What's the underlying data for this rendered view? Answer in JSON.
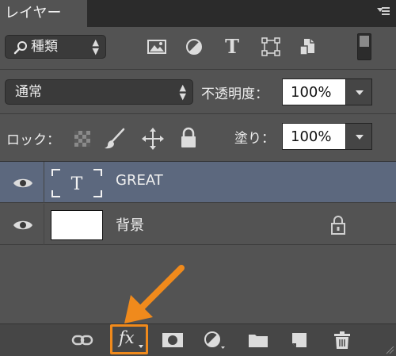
{
  "panel": {
    "tab_title": "レイヤー"
  },
  "filter": {
    "kind_label": "種類",
    "icons": [
      "image-filter-icon",
      "adjustment-filter-icon",
      "type-filter-icon",
      "shape-filter-icon",
      "smart-object-filter-icon"
    ],
    "type_glyph": "T"
  },
  "blend": {
    "mode": "通常",
    "opacity_label": "不透明度：",
    "opacity_value": "100%"
  },
  "lock": {
    "label": "ロック：",
    "fill_label": "塗り：",
    "fill_value": "100%"
  },
  "layers": [
    {
      "name": "GREAT",
      "type": "text",
      "thumb_glyph": "T",
      "selected": true,
      "visible": true
    },
    {
      "name": "背景",
      "type": "background",
      "selected": false,
      "visible": true,
      "locked": true
    }
  ],
  "bottom": {
    "fx_label": "fx",
    "icons": [
      "link-layers-icon",
      "fx-icon",
      "add-mask-icon",
      "adjustment-layer-icon",
      "group-folder-icon",
      "new-layer-icon",
      "trash-icon"
    ]
  },
  "colors": {
    "panel_bg": "#535353",
    "tabbar_bg": "#2b2b2b",
    "selected_row": "#5c687e",
    "highlight": "#f08a1c"
  }
}
